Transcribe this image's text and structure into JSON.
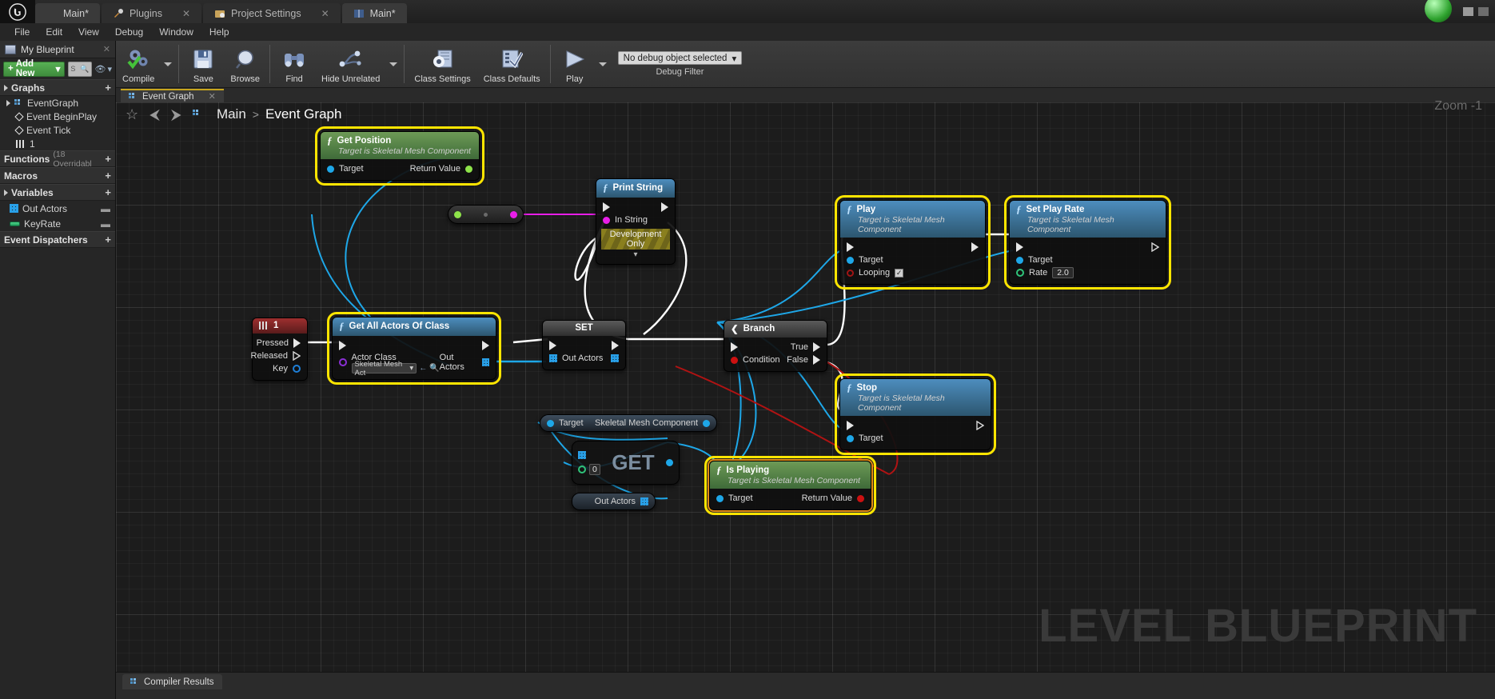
{
  "titlebar": {
    "tabs": [
      {
        "label": "Main*",
        "icon": "blueprint-icon",
        "closable": false,
        "active": true
      },
      {
        "label": "Plugins",
        "icon": "plugin-icon",
        "closable": true,
        "active": false
      },
      {
        "label": "Project Settings",
        "icon": "settings-folder-icon",
        "closable": true,
        "active": false
      },
      {
        "label": "Main*",
        "icon": "book-icon",
        "closable": false,
        "active": true
      }
    ]
  },
  "menubar": {
    "items": [
      "File",
      "Edit",
      "View",
      "Debug",
      "Window",
      "Help"
    ]
  },
  "toolbar": {
    "buttons": [
      {
        "label": "Compile",
        "icon": "gear-check-icon",
        "dropdown": true
      },
      {
        "label": "Save",
        "icon": "floppy-disk-icon",
        "dropdown": false
      },
      {
        "label": "Browse",
        "icon": "magnifier-icon",
        "dropdown": false
      },
      {
        "label": "Find",
        "icon": "binoculars-icon",
        "dropdown": false
      },
      {
        "label": "Hide Unrelated",
        "icon": "node-graph-icon",
        "dropdown": true
      },
      {
        "label": "Class Settings",
        "icon": "gear-document-icon",
        "dropdown": false
      },
      {
        "label": "Class Defaults",
        "icon": "checklist-icon",
        "dropdown": false
      },
      {
        "label": "Play",
        "icon": "play-triangle-icon",
        "dropdown": true
      }
    ],
    "debug": {
      "selected": "No debug object selected",
      "caption": "Debug Filter"
    }
  },
  "myblueprint": {
    "title": "My Blueprint",
    "add_new_label": "Add New",
    "search_placeholder": "S",
    "sections": {
      "graphs": "Graphs",
      "functions": "Functions",
      "functions_note": "(18 Overridabl",
      "macros": "Macros",
      "variables": "Variables",
      "event_dispatchers": "Event Dispatchers"
    },
    "graph_items": [
      {
        "label": "EventGraph",
        "icon": "event-graph-icon",
        "indent": 0
      },
      {
        "label": "Event BeginPlay",
        "icon": "event-node-icon",
        "indent": 1
      },
      {
        "label": "Event Tick",
        "icon": "event-node-icon",
        "indent": 1
      },
      {
        "label": "1",
        "icon": "key-event-icon",
        "indent": 1
      }
    ],
    "variables": [
      {
        "label": "Out Actors",
        "icon": "array-variable-icon"
      },
      {
        "label": "KeyRate",
        "icon": "float-variable-icon"
      }
    ]
  },
  "graph_tab": {
    "label": "Event Graph",
    "icon": "event-graph-icon"
  },
  "breadcrumb": {
    "root": "Main",
    "separator": ">",
    "current": "Event Graph"
  },
  "zoom": {
    "label": "Zoom -1"
  },
  "watermark": "LEVEL BLUEPRINT",
  "bottom": {
    "compiler_results": "Compiler Results",
    "icon": "compiler-icon"
  },
  "nodes": {
    "get_position": {
      "title": "Get Position",
      "subtitle": "Target is Skeletal Mesh Component",
      "in_pin": "Target",
      "out_pin": "Return Value",
      "selected": true
    },
    "print_string": {
      "title": "Print String",
      "in_pin": "In String",
      "dev_only": "Development Only"
    },
    "play": {
      "title": "Play",
      "subtitle": "Target is Skeletal Mesh Component",
      "target": "Target",
      "looping": "Looping",
      "looping_checked": "✓",
      "selected": true
    },
    "set_play_rate": {
      "title": "Set Play Rate",
      "subtitle": "Target is Skeletal Mesh Component",
      "target": "Target",
      "rate_label": "Rate",
      "rate_value": "2.0",
      "selected": true
    },
    "stop": {
      "title": "Stop",
      "subtitle": "Target is Skeletal Mesh Component",
      "target": "Target",
      "selected": true
    },
    "branch": {
      "title": "Branch",
      "condition": "Condition",
      "true_label": "True",
      "false_label": "False"
    },
    "set": {
      "title": "SET",
      "pin": "Out Actors"
    },
    "key_event": {
      "title": "1",
      "pressed": "Pressed",
      "released": "Released",
      "key": "Key"
    },
    "get_all_actors": {
      "title": "Get All Actors Of Class",
      "actor_class_label": "Actor Class",
      "actor_class_value": "Skeletal Mesh Act",
      "out_actors": "Out Actors",
      "selected": true
    },
    "target_var": {
      "target": "Target",
      "output": "Skeletal Mesh Component"
    },
    "get_array": {
      "title": "GET",
      "index": "0"
    },
    "out_actors_var": {
      "label": "Out Actors"
    },
    "is_playing": {
      "title": "Is Playing",
      "subtitle": "Target is Skeletal Mesh Component",
      "target": "Target",
      "return_value": "Return Value",
      "selected": true
    }
  },
  "colors": {
    "selection": "#ffe500",
    "exec_wire": "#ffffff",
    "data_wire": "#1ea7e8",
    "bool_wire": "#b01313",
    "string_wire": "#e81ee8",
    "accent_green": "#57b054"
  }
}
